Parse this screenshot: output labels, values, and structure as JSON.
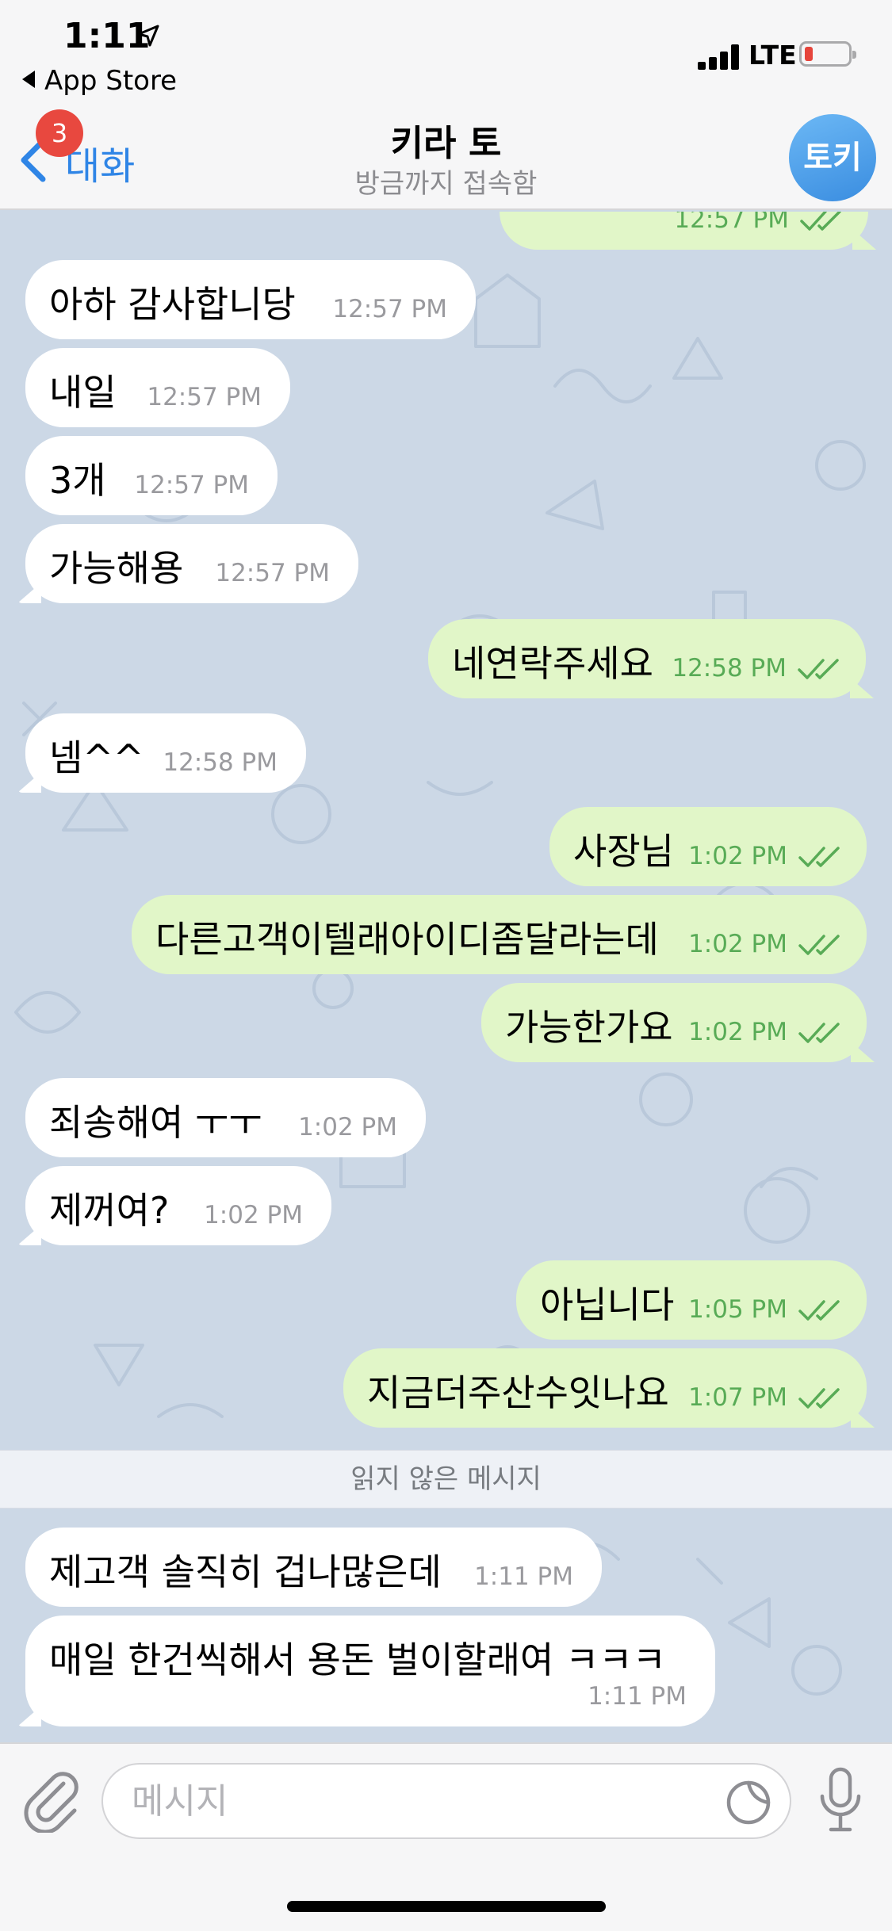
{
  "status_bar": {
    "time": "1:11",
    "back_app": "App Store",
    "network": "LTE"
  },
  "nav": {
    "back_label": "대화",
    "unread_badge": "3",
    "title": "키라 토",
    "subtitle": "방금까지 접속함",
    "avatar_text": "토키"
  },
  "messages": [
    {
      "dir": "in",
      "text": "아하 감사합니당",
      "time": "12:57 PM"
    },
    {
      "dir": "in",
      "text": "내일",
      "time": "12:57 PM"
    },
    {
      "dir": "in",
      "text": "3개",
      "time": "12:57 PM"
    },
    {
      "dir": "in",
      "text": "가능해용",
      "time": "12:57 PM"
    },
    {
      "dir": "out",
      "text": "네연락주세요",
      "time": "12:58 PM"
    },
    {
      "dir": "in",
      "text": "넴^^",
      "time": "12:58 PM"
    },
    {
      "dir": "out",
      "text": "사장님",
      "time": "1:02 PM"
    },
    {
      "dir": "out",
      "text": "다른고객이텔래아이디좀달라는데",
      "time": "1:02 PM"
    },
    {
      "dir": "out",
      "text": "가능한가요",
      "time": "1:02 PM"
    },
    {
      "dir": "in",
      "text": "죄송해여 ㅜㅜ",
      "time": "1:02 PM"
    },
    {
      "dir": "in",
      "text": "제꺼여?",
      "time": "1:02 PM"
    },
    {
      "dir": "out",
      "text": "아닙니다",
      "time": "1:05 PM"
    },
    {
      "dir": "out",
      "text": "지금더주산수잇나요",
      "time": "1:07 PM"
    },
    {
      "dir": "in",
      "text": "제고객 솔직히 겁나많은데",
      "time": "1:11 PM"
    },
    {
      "dir": "in",
      "text": "매일 한건씩해서 용돈 벌이할래여 ㅋㅋㅋ",
      "time": "1:11 PM"
    }
  ],
  "partial_top_time": "12:57 PM",
  "unread_divider": "읽지 않은 메시지",
  "input": {
    "placeholder": "메시지"
  },
  "colors": {
    "accent": "#2f85e6",
    "outgoing": "#e1f6c8",
    "incoming": "#ffffff",
    "badge": "#e8483f",
    "wallpaper": "#ccd8e6"
  },
  "icons": [
    "location-arrow-icon",
    "chevron-left-icon",
    "signal-icon",
    "battery-icon",
    "double-check-icon",
    "paperclip-icon",
    "sticker-icon",
    "microphone-icon"
  ]
}
